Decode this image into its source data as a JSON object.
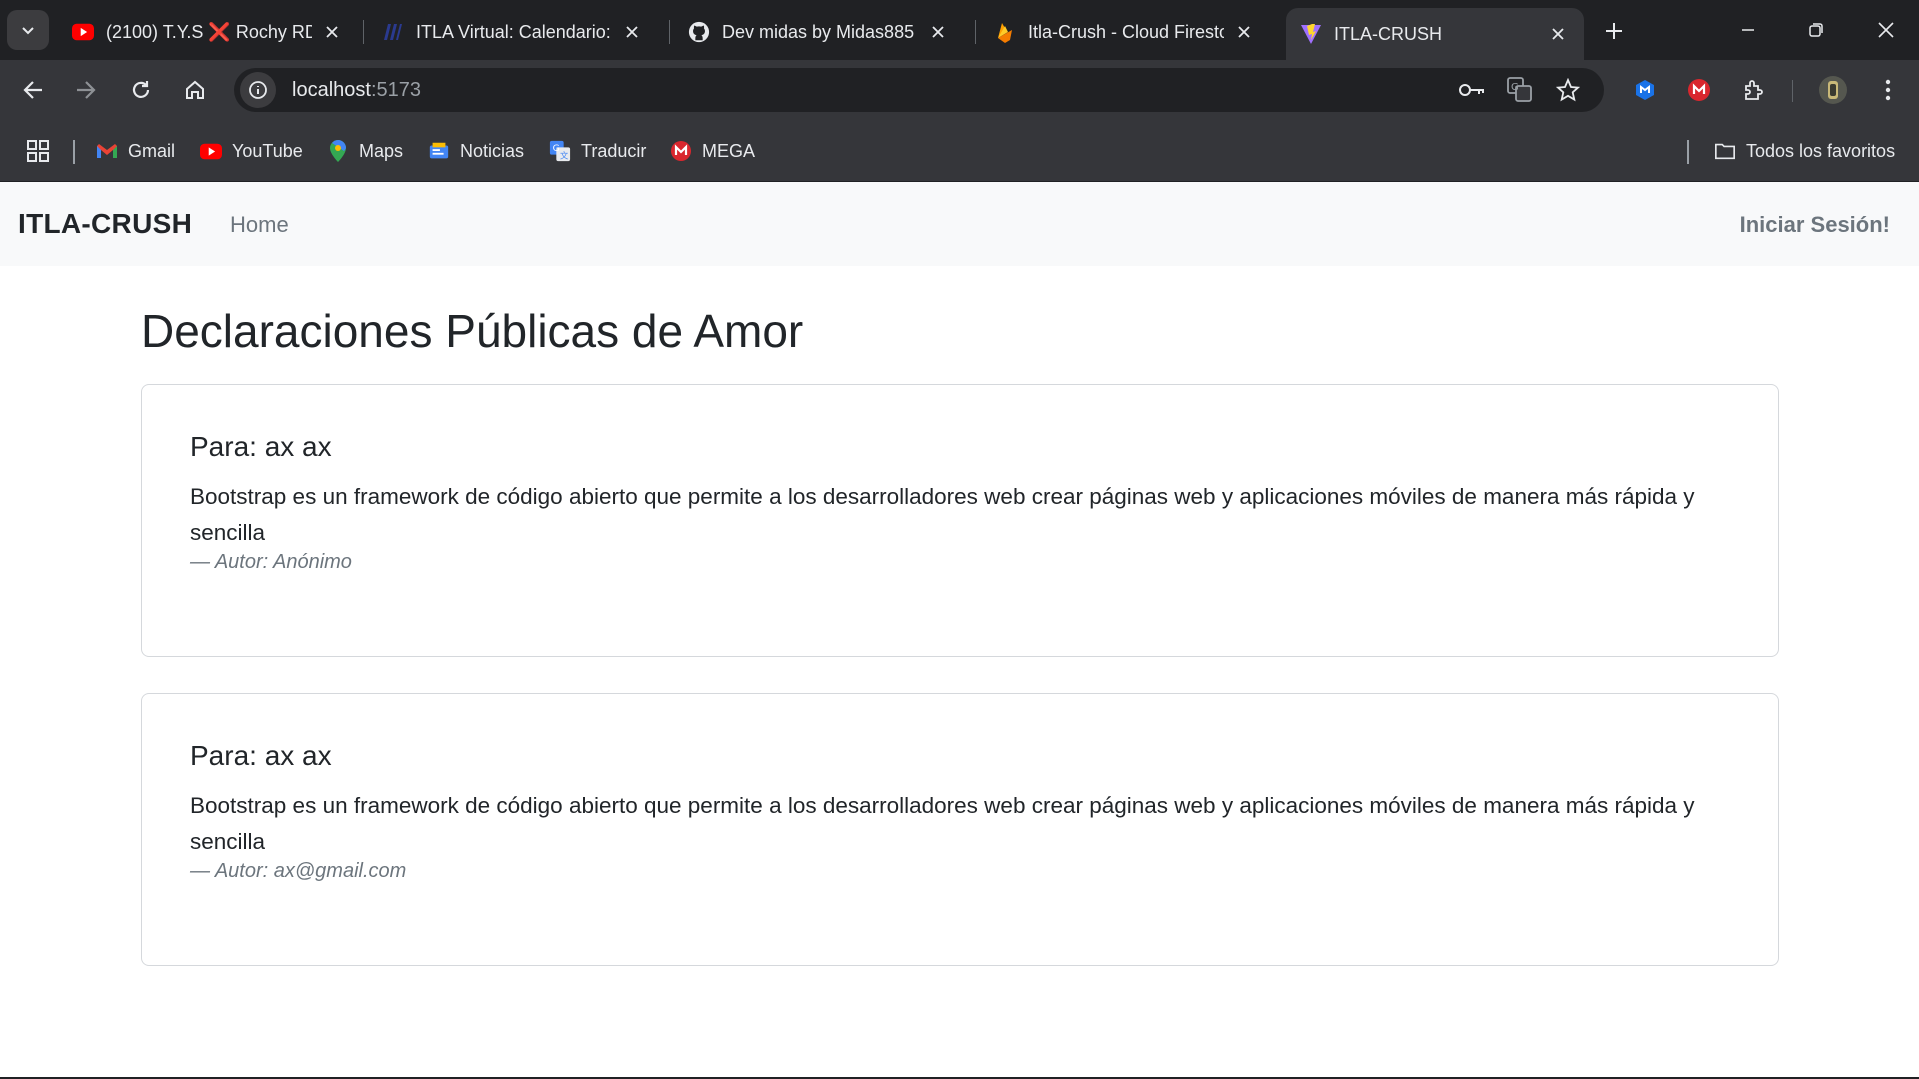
{
  "browser": {
    "tabs": [
      {
        "title": "(2100) T.Y.S ❌ Rochy RD",
        "icon": "youtube-icon"
      },
      {
        "title": "ITLA Virtual: Calendario: V",
        "icon": "itla-icon"
      },
      {
        "title": "Dev midas by Midas885 ·",
        "icon": "github-icon"
      },
      {
        "title": "Itla-Crush - Cloud Firesto",
        "icon": "firebase-icon"
      },
      {
        "title": "ITLA-CRUSH",
        "icon": "vite-icon"
      }
    ],
    "url": "localhost",
    "url_port": ":5173",
    "bookmarks": [
      {
        "label": "Gmail",
        "icon": "gmail-icon"
      },
      {
        "label": "YouTube",
        "icon": "youtube-icon"
      },
      {
        "label": "Maps",
        "icon": "maps-icon"
      },
      {
        "label": "Noticias",
        "icon": "news-icon"
      },
      {
        "label": "Traducir",
        "icon": "translate-icon"
      },
      {
        "label": "MEGA",
        "icon": "mega-icon"
      }
    ],
    "all_bookmarks_label": "Todos los favoritos",
    "colors": {
      "chrome_dark": "#202124",
      "chrome_mid": "#35363a",
      "text": "#e8eaed"
    }
  },
  "app": {
    "brand": "ITLA-CRUSH",
    "nav_home": "Home",
    "nav_login": "Iniciar Sesión!",
    "heading": "Declaraciones Públicas de Amor",
    "posts": [
      {
        "to": "Para: ax ax",
        "text": "Bootstrap es un framework de código abierto que permite a los desarrolladores web crear páginas web y aplicaciones móviles de manera más rápida y sencilla",
        "author": "— Autor: Anónimo"
      },
      {
        "to": "Para: ax ax",
        "text": "Bootstrap es un framework de código abierto que permite a los desarrolladores web crear páginas web y aplicaciones móviles de manera más rápida y sencilla",
        "author": "— Autor: ax@gmail.com"
      }
    ]
  }
}
